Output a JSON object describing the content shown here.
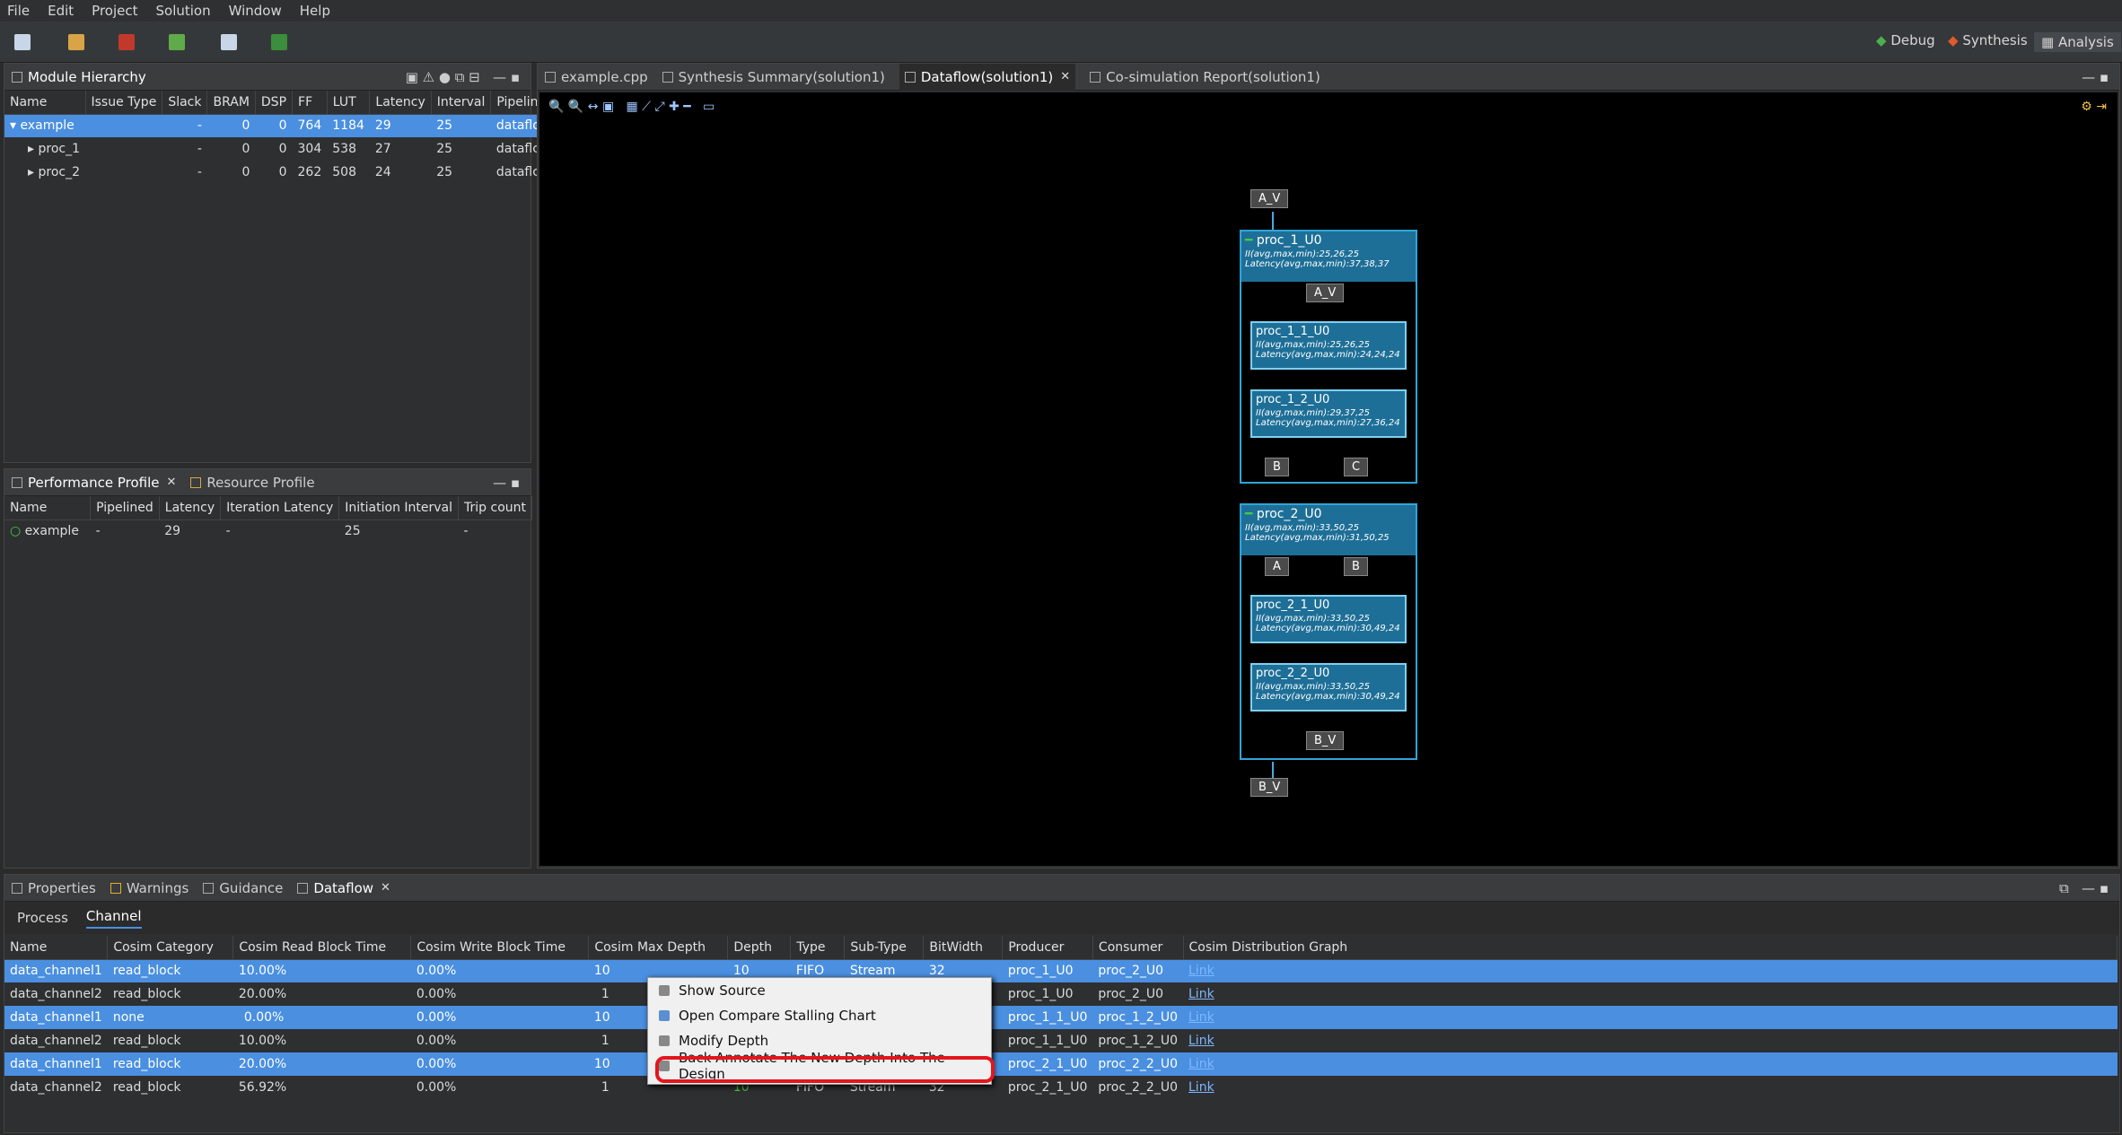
{
  "menu": [
    "File",
    "Edit",
    "Project",
    "Solution",
    "Window",
    "Help"
  ],
  "perspectives": [
    "Debug",
    "Synthesis",
    "Analysis"
  ],
  "module_hierarchy": {
    "title": "Module Hierarchy",
    "columns": [
      "Name",
      "Issue Type",
      "Slack",
      "BRAM",
      "DSP",
      "FF",
      "LUT",
      "Latency",
      "Interval",
      "Pipeline"
    ],
    "rows": [
      {
        "name": "example",
        "issue": "",
        "slack": "-",
        "bram": "0",
        "dsp": "0",
        "ff": "764",
        "lut": "1184",
        "latency": "29",
        "interval": "25",
        "pipeline": "dataflo"
      },
      {
        "name": "proc_1",
        "issue": "",
        "slack": "-",
        "bram": "0",
        "dsp": "0",
        "ff": "304",
        "lut": "538",
        "latency": "27",
        "interval": "25",
        "pipeline": "dataflc"
      },
      {
        "name": "proc_2",
        "issue": "",
        "slack": "-",
        "bram": "0",
        "dsp": "0",
        "ff": "262",
        "lut": "508",
        "latency": "24",
        "interval": "25",
        "pipeline": "dataflc"
      }
    ]
  },
  "perf_profile": {
    "tab1": "Performance Profile",
    "tab2": "Resource Profile",
    "columns": [
      "Name",
      "Pipelined",
      "Latency",
      "Iteration Latency",
      "Initiation Interval",
      "Trip count"
    ],
    "rows": [
      {
        "name": "example",
        "pipelined": "-",
        "latency": "29",
        "iter": "-",
        "ii": "25",
        "trip": "-"
      }
    ]
  },
  "editor_tabs": [
    "example.cpp",
    "Synthesis Summary(solution1)",
    "Dataflow(solution1)",
    "Co-simulation Report(solution1)"
  ],
  "graph": {
    "top_in": "A_V",
    "top_out": "B_V",
    "proc1": {
      "name": "proc_1_U0",
      "ii": "II(avg,max,min):25,26,25",
      "lat": "Latency(avg,max,min):37,38,37",
      "port": "A_V",
      "sub1": {
        "name": "proc_1_1_U0",
        "ii": "II(avg,max,min):25,26,25",
        "lat": "Latency(avg,max,min):24,24,24"
      },
      "sub2": {
        "name": "proc_1_2_U0",
        "ii": "II(avg,max,min):29,37,25",
        "lat": "Latency(avg,max,min):27,36,24"
      },
      "outA": "B",
      "outB": "C"
    },
    "proc2": {
      "name": "proc_2_U0",
      "ii": "II(avg,max,min):33,50,25",
      "lat": "Latency(avg,max,min):31,50,25",
      "inA": "A",
      "inB": "B",
      "sub1": {
        "name": "proc_2_1_U0",
        "ii": "II(avg,max,min):33,50,25",
        "lat": "Latency(avg,max,min):30,49,24"
      },
      "sub2": {
        "name": "proc_2_2_U0",
        "ii": "II(avg,max,min):33,50,25",
        "lat": "Latency(avg,max,min):30,49,24"
      },
      "out": "B_V"
    }
  },
  "bottom_tabs": [
    "Properties",
    "Warnings",
    "Guidance",
    "Dataflow"
  ],
  "subtabs": [
    "Process",
    "Channel"
  ],
  "channel_table": {
    "columns": [
      "Name",
      "Cosim Category",
      "Cosim Read Block Time",
      "Cosim Write Block Time",
      "Cosim Max Depth",
      "Depth",
      "Type",
      "Sub-Type",
      "BitWidth",
      "Producer",
      "Consumer",
      "Cosim Distribution Graph"
    ],
    "rows": [
      {
        "name": "data_channel1",
        "cat": "read_block",
        "rbt": "10.00%",
        "wbt": "0.00%",
        "max": "10",
        "depth": "10",
        "type": "FIFO",
        "sub": "Stream",
        "bw": "32",
        "prod": "proc_1_U0",
        "cons": "proc_2_U0",
        "link": "Link"
      },
      {
        "name": "data_channel2",
        "cat": "read_block",
        "rbt": "20.00%",
        "wbt": "0.00%",
        "max": "1",
        "depth": "",
        "type": "",
        "sub": "",
        "bw": "",
        "prod": "proc_1_U0",
        "cons": "proc_2_U0",
        "link": "Link"
      },
      {
        "name": "data_channel1",
        "cat": "none",
        "rbt": "0.00%",
        "wbt": "0.00%",
        "max": "10",
        "depth": "",
        "type": "",
        "sub": "",
        "bw": "",
        "prod": "proc_1_1_U0",
        "cons": "proc_1_2_U0",
        "link": "Link"
      },
      {
        "name": "data_channel2",
        "cat": "read_block",
        "rbt": "10.00%",
        "wbt": "0.00%",
        "max": "1",
        "depth": "",
        "type": "",
        "sub": "",
        "bw": "",
        "prod": "proc_1_1_U0",
        "cons": "proc_1_2_U0",
        "link": "Link"
      },
      {
        "name": "data_channel1",
        "cat": "read_block",
        "rbt": "20.00%",
        "wbt": "0.00%",
        "max": "10",
        "depth": "",
        "type": "",
        "sub": "",
        "bw": "",
        "prod": "proc_2_1_U0",
        "cons": "proc_2_2_U0",
        "link": "Link"
      },
      {
        "name": "data_channel2",
        "cat": "read_block",
        "rbt": "56.92%",
        "wbt": "0.00%",
        "max": "1",
        "depth": "10",
        "type": "FIFO",
        "sub": "Stream",
        "bw": "32",
        "prod": "proc_2_1_U0",
        "cons": "proc_2_2_U0",
        "link": "Link"
      }
    ]
  },
  "context_menu": [
    "Show Source",
    "Open Compare Stalling Chart",
    "Modify Depth",
    "Back Annotate The New Depth Into The Design"
  ],
  "colors": {
    "selection": "#4a8fe0",
    "node": "#1e6f97",
    "highlight": "#e4161b"
  }
}
